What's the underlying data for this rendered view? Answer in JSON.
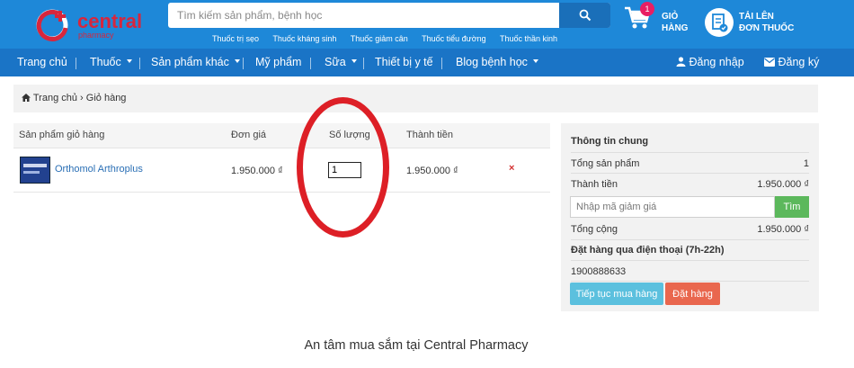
{
  "header": {
    "logo_text": "central",
    "logo_sub": "pharmacy",
    "search_placeholder": "Tìm kiếm sản phẩm, bệnh học",
    "quick_links": [
      "Thuốc trị sẹo",
      "Thuốc kháng sinh",
      "Thuốc giảm cân",
      "Thuốc tiểu đường",
      "Thuốc thần kinh"
    ],
    "cart_count": "1",
    "cart_label_1": "GIỎ",
    "cart_label_2": "HÀNG",
    "upload_label_1": "TẢI LÊN",
    "upload_label_2": "ĐƠN THUỐC",
    "brand_color": "#d7263d",
    "header_color": "#1e88d8"
  },
  "nav": {
    "items": [
      "Trang chủ",
      "Thuốc",
      "Sản phẩm khác",
      "Mỹ phẩm",
      "Sữa",
      "Thiết bị y tế",
      "Blog bệnh học"
    ],
    "login": "Đăng nhập",
    "register": "Đăng ký"
  },
  "breadcrumb": {
    "home": "Trang chủ",
    "separator": "›",
    "current": "Giỏ hàng"
  },
  "cart": {
    "headers": [
      "Sản phẩm giỏ hàng",
      "Đơn giá",
      "Số lượng",
      "Thành tiền"
    ],
    "rows": [
      {
        "name": "Orthomol Arthroplus",
        "unit_price": "1.950.000 ₫",
        "quantity": "1",
        "total": "1.950.000 ₫",
        "remove": "×"
      }
    ]
  },
  "summary": {
    "title": "Thông tin chung",
    "total_products_label": "Tổng sản phẩm",
    "total_products_value": "1",
    "subtotal_label": "Thành tiền",
    "subtotal_value": "1.950.000 ₫",
    "coupon_placeholder": "Nhập mã giảm giá",
    "coupon_button": "Tìm",
    "grand_total_label": "Tổng cộng",
    "grand_total_value": "1.950.000 ₫",
    "phone_order_label": "Đặt hàng qua điện thoại (7h-22h)",
    "phone_number": "1900888633",
    "continue_button": "Tiếp tục mua hàng",
    "order_button": "Đặt hàng"
  },
  "footer": {
    "title": "An tâm mua sắm tại Central Pharmacy"
  }
}
